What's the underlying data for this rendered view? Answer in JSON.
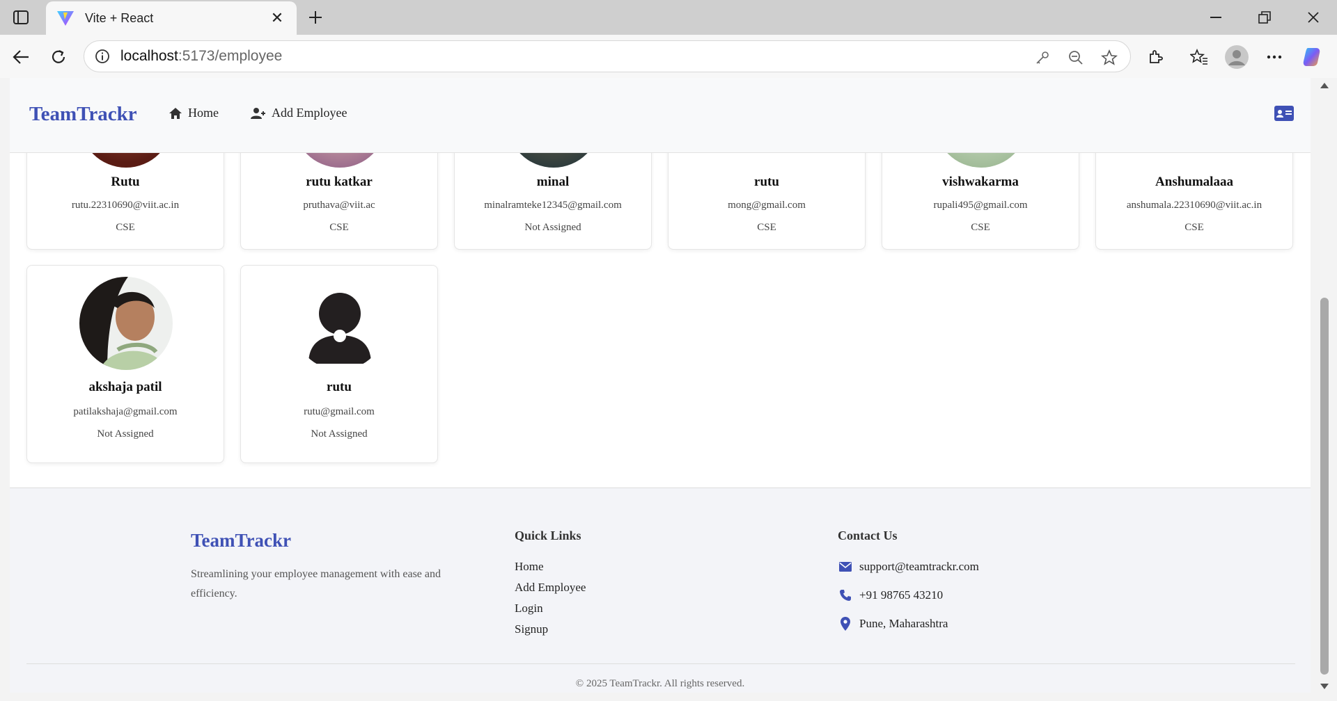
{
  "browser": {
    "tab_title": "Vite + React",
    "url_host": "localhost",
    "url_path": ":5173/employee"
  },
  "navbar": {
    "brand": "TeamTrackr",
    "links": [
      {
        "label": "Home",
        "icon": "home-icon"
      },
      {
        "label": "Add Employee",
        "icon": "user-plus-icon"
      }
    ],
    "right_icon": "id-card-icon"
  },
  "employees": [
    {
      "name": "Rutu",
      "email": "rutu.22310690@viit.ac.in",
      "department": "CSE"
    },
    {
      "name": "rutu katkar",
      "email": "pruthava@viit.ac",
      "department": "CSE"
    },
    {
      "name": "minal",
      "email": "minalramteke12345@gmail.com",
      "department": "Not Assigned"
    },
    {
      "name": "rutu",
      "email": "mong@gmail.com",
      "department": "CSE"
    },
    {
      "name": "vishwakarma",
      "email": "rupali495@gmail.com",
      "department": "CSE"
    },
    {
      "name": "Anshumalaaa",
      "email": "anshumala.22310690@viit.ac.in",
      "department": "CSE"
    },
    {
      "name": "akshaja patil",
      "email": "patilakshaja@gmail.com",
      "department": "Not Assigned"
    },
    {
      "name": "rutu",
      "email": "rutu@gmail.com",
      "department": "Not Assigned"
    }
  ],
  "footer": {
    "brand": "TeamTrackr",
    "tagline": "Streamlining your employee management with ease and efficiency.",
    "quick_links_title": "Quick Links",
    "quick_links": [
      "Home",
      "Add Employee",
      "Login",
      "Signup"
    ],
    "contact_title": "Contact Us",
    "contact": {
      "email": "support@teamtrackr.com",
      "phone": "+91 98765 43210",
      "location": "Pune, Maharashtra"
    },
    "copyright": "© 2025 TeamTrackr. All rights reserved."
  },
  "colors": {
    "brand": "#3f51b5",
    "navbar_bg": "#f8f9fa",
    "footer_bg": "#f3f4f8"
  }
}
